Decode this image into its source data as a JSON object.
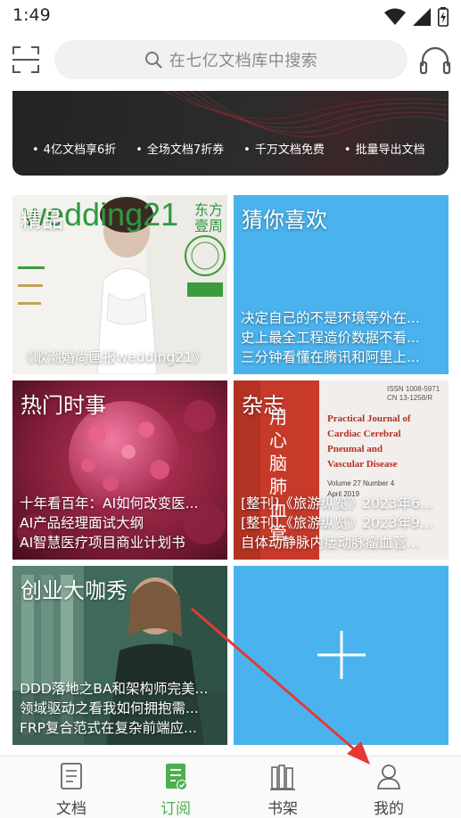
{
  "status_bar": {
    "time": "1:49",
    "icons": [
      "wifi-icon",
      "signal-icon",
      "battery-charging-icon"
    ]
  },
  "header": {
    "scan_icon": "scan-icon",
    "search_placeholder": "在七亿文档库中搜索",
    "headset_icon": "headset-icon"
  },
  "banner": {
    "perks": [
      "4亿文档享6折",
      "全场文档7折券",
      "千万文档免费",
      "批量导出文档"
    ]
  },
  "tiles": [
    {
      "title": "精品",
      "lines": [
        "《歌潮婚尚画报wedding21》"
      ],
      "cover_text": "wedding21"
    },
    {
      "title": "猜你喜欢",
      "lines": [
        "决定自己的不是环境等外在...",
        "史上最全工程造价数据不看...",
        "三分钟看懂在腾讯和阿里上..."
      ]
    },
    {
      "title": "热门时事",
      "lines": [
        "十年看百年：AI如何改变医...",
        "AI产品经理面试大纲",
        "AI智慧医疗项目商业计划书"
      ]
    },
    {
      "title": "杂志",
      "lines": [
        "[整刊]《旅游纵览》2023年6...",
        "[整刊]《旅游纵览》2023年9...",
        "自体动静脉内瘘动脉瘤血管..."
      ],
      "cover_text": "Practical Journal of Cardiac Cerebral Pneumal and Vascular Disease"
    },
    {
      "title": "创业大咖秀",
      "lines": [
        "DDD落地之BA和架构师完美...",
        "领域驱动之看我如何拥抱需...",
        "FRP复合范式在复杂前端应..."
      ]
    },
    {
      "title": "",
      "lines": [],
      "add_icon": "plus-icon"
    }
  ],
  "bottom_nav": {
    "items": [
      {
        "label": "文档",
        "icon": "document-icon",
        "active": false
      },
      {
        "label": "订阅",
        "icon": "subscribe-icon",
        "active": true
      },
      {
        "label": "书架",
        "icon": "bookshelf-icon",
        "active": false
      },
      {
        "label": "我的",
        "icon": "profile-icon",
        "active": false
      }
    ]
  },
  "colors": {
    "accent_green": "#4caf50",
    "tile_blue": "#4ab3ee",
    "annotation_red": "#e53935"
  }
}
